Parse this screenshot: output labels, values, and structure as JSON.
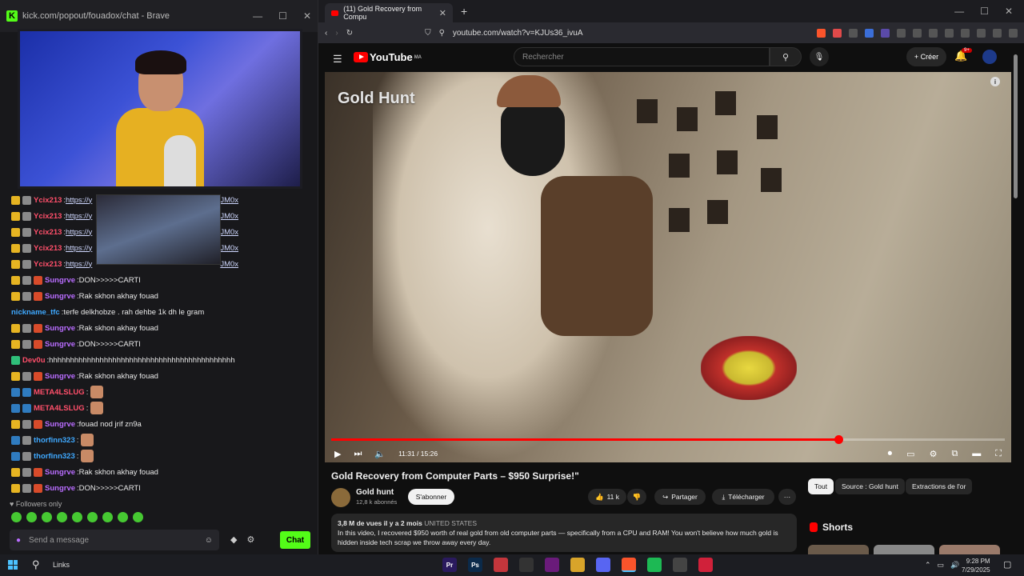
{
  "kick": {
    "title_url": "kick.com/popout/fouadox/chat - Brave",
    "followers_only": "Followers only",
    "input_placeholder": "Send a message",
    "chat_button": "Chat",
    "messages": [
      {
        "user": "Ycix213",
        "color": "#ff4f6a",
        "text": "https://y",
        "suffix": "JM0x",
        "badges": [
          "crown",
          "gray"
        ],
        "link": true
      },
      {
        "user": "Ycix213",
        "color": "#ff4f6a",
        "text": "https://y",
        "suffix": "JM0x",
        "badges": [
          "crown",
          "gray"
        ],
        "link": true
      },
      {
        "user": "Ycix213",
        "color": "#ff4f6a",
        "text": "https://y",
        "suffix": "JM0x",
        "badges": [
          "crown",
          "gray"
        ],
        "link": true
      },
      {
        "user": "Ycix213",
        "color": "#ff4f6a",
        "text": "https://y",
        "suffix": "JM0x",
        "badges": [
          "crown",
          "gray"
        ],
        "link": true
      },
      {
        "user": "Ycix213",
        "color": "#ff4f6a",
        "text": "https://y",
        "suffix": "JM0x",
        "badges": [
          "crown",
          "gray"
        ],
        "link": true
      },
      {
        "user": "Sungrve",
        "color": "#b96dff",
        "text": "DON>>>>>CARTI",
        "badges": [
          "crown",
          "gray",
          "red"
        ]
      },
      {
        "user": "Sungrve",
        "color": "#b96dff",
        "text": "Rak skhon akhay fouad",
        "badges": [
          "crown",
          "gray",
          "red"
        ]
      },
      {
        "user": "nickname_tfc",
        "color": "#3fa9ff",
        "text": "terfe delkhobze . rah dehbe 1k dh le gram",
        "badges": []
      },
      {
        "user": "Sungrve",
        "color": "#b96dff",
        "text": "Rak skhon akhay fouad",
        "badges": [
          "crown",
          "gray",
          "red"
        ]
      },
      {
        "user": "Sungrve",
        "color": "#b96dff",
        "text": "DON>>>>>CARTI",
        "badges": [
          "crown",
          "gray",
          "red"
        ]
      },
      {
        "user": "Dev0u",
        "color": "#ff4f6a",
        "text": "hhhhhhhhhhhhhhhhhhhhhhhhhhhhhhhhhhhhhhhhhhhh",
        "badges": [
          "green"
        ]
      },
      {
        "user": "Sungrve",
        "color": "#b96dff",
        "text": "Rak skhon akhay fouad",
        "badges": [
          "crown",
          "gray",
          "red"
        ]
      },
      {
        "user": "META4LSLUG",
        "color": "#ff4f6a",
        "text": "",
        "badges": [
          "teal",
          "teal"
        ],
        "emote": true
      },
      {
        "user": "META4LSLUG",
        "color": "#ff4f6a",
        "text": "",
        "badges": [
          "teal",
          "teal"
        ],
        "emote": true
      },
      {
        "user": "Sungrve",
        "color": "#b96dff",
        "text": "fouad nod jrif zn9a",
        "badges": [
          "crown",
          "gray",
          "red"
        ]
      },
      {
        "user": "thorfinn323",
        "color": "#3fa9ff",
        "text": "",
        "badges": [
          "teal",
          "gray"
        ],
        "emote": true
      },
      {
        "user": "thorfinn323",
        "color": "#3fa9ff",
        "text": "",
        "badges": [
          "teal",
          "gray"
        ],
        "emote": true
      },
      {
        "user": "Sungrve",
        "color": "#b96dff",
        "text": "Rak skhon akhay fouad",
        "badges": [
          "crown",
          "gray",
          "red"
        ]
      },
      {
        "user": "Sungrve",
        "color": "#b96dff",
        "text": "DON>>>>>CARTI",
        "badges": [
          "crown",
          "gray",
          "red"
        ]
      }
    ]
  },
  "browser": {
    "tab_title": "(11) Gold Recovery from Compu",
    "url": "youtube.com/watch?v=KJUs36_ivuA"
  },
  "youtube": {
    "logo": "YouTube",
    "region": "MA",
    "search_placeholder": "Rechercher",
    "create_label": "Créer",
    "notif_count": "9+",
    "video_overlay_title": "Gold Hunt",
    "time": "11:31 / 15:26",
    "progress": 0.753,
    "title": "Gold Recovery from Computer Parts – $950 Surprise!\"",
    "channel": "Gold hunt",
    "subscribers": "12,8 k abonnés",
    "subscribe": "S'abonner",
    "likes": "11 k",
    "share": "Partager",
    "download": "Télécharger",
    "more": "···",
    "desc_views": "3,8 M de vues  il y a 2 mois",
    "desc_country": "UNITED STATES",
    "desc_text": "In this video, I recovered $950 worth of real gold from old computer parts — specifically from a CPU and RAM! You won't believe how much gold is hidden inside tech scrap we throw away every day.",
    "chips": [
      "Tout",
      "Source : Gold hunt",
      "Extractions de l'or"
    ],
    "shorts": "Shorts"
  },
  "taskbar": {
    "links": "Links",
    "time": "9:28 PM",
    "date": "7/29/2025",
    "apps": [
      {
        "label": "Pr",
        "color": "#2a1a5e"
      },
      {
        "label": "Ps",
        "color": "#0b2a4a"
      },
      {
        "label": "",
        "color": "#c4363c"
      },
      {
        "label": "",
        "color": "#333"
      },
      {
        "label": "",
        "color": "#6a1b7a"
      },
      {
        "label": "",
        "color": "#d8a42a"
      },
      {
        "label": "",
        "color": "#5865f2"
      },
      {
        "label": "",
        "color": "#fb542b"
      },
      {
        "label": "",
        "color": "#1db954"
      },
      {
        "label": "",
        "color": "#444"
      },
      {
        "label": "",
        "color": "#d0213a"
      }
    ]
  }
}
